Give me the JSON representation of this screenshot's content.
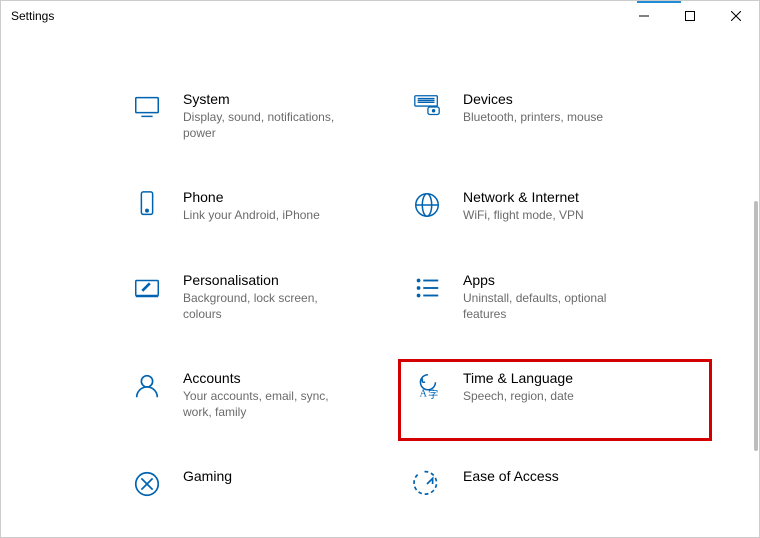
{
  "window": {
    "title": "Settings"
  },
  "categories": [
    {
      "id": "system",
      "name": "System",
      "desc": "Display, sound, notifications, power"
    },
    {
      "id": "devices",
      "name": "Devices",
      "desc": "Bluetooth, printers, mouse"
    },
    {
      "id": "phone",
      "name": "Phone",
      "desc": "Link your Android, iPhone"
    },
    {
      "id": "network",
      "name": "Network & Internet",
      "desc": "WiFi, flight mode, VPN"
    },
    {
      "id": "personalisation",
      "name": "Personalisation",
      "desc": "Background, lock screen, colours"
    },
    {
      "id": "apps",
      "name": "Apps",
      "desc": "Uninstall, defaults, optional features"
    },
    {
      "id": "accounts",
      "name": "Accounts",
      "desc": "Your accounts, email, sync, work, family"
    },
    {
      "id": "time-language",
      "name": "Time & Language",
      "desc": "Speech, region, date",
      "highlighted": true
    },
    {
      "id": "gaming",
      "name": "Gaming",
      "desc": ""
    },
    {
      "id": "ease-of-access",
      "name": "Ease of Access",
      "desc": ""
    }
  ],
  "colors": {
    "icon": "#0063B1",
    "highlight": "#d40000"
  }
}
